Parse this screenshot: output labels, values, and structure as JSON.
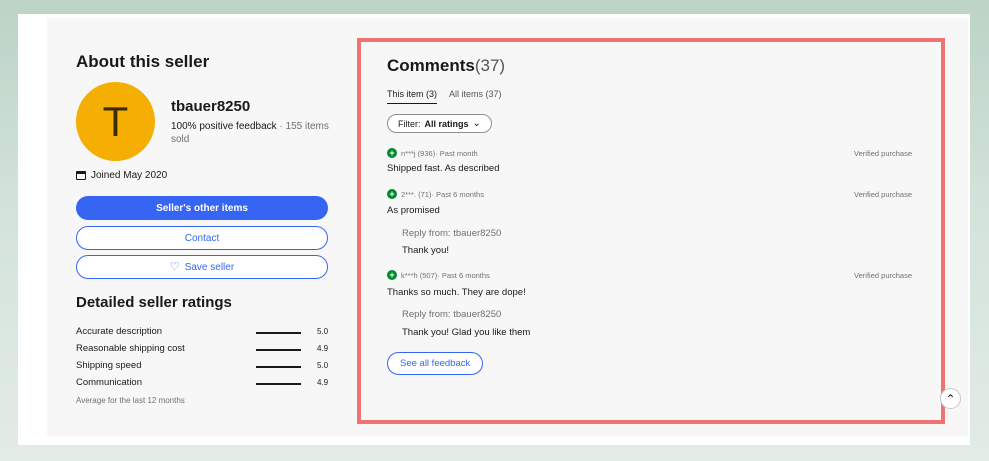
{
  "seller": {
    "heading": "About this seller",
    "avatar_letter": "T",
    "username": "tbauer8250",
    "feedback": "100% positive feedback",
    "items_sold": " · 155 items sold",
    "joined": "Joined May 2020",
    "buttons": {
      "other_items": "Seller's other items",
      "contact": "Contact",
      "save": "Save seller"
    }
  },
  "ratings": {
    "heading": "Detailed seller ratings",
    "items": [
      {
        "label": "Accurate description",
        "value": "5.0"
      },
      {
        "label": "Reasonable shipping cost",
        "value": "4.9"
      },
      {
        "label": "Shipping speed",
        "value": "5.0"
      },
      {
        "label": "Communication",
        "value": "4.9"
      }
    ],
    "footnote": "Average for the last 12 months"
  },
  "comments": {
    "title": "Comments",
    "count": "(37)",
    "tabs": [
      "This item (3)",
      "All items (37)"
    ],
    "filter_prefix": "Filter: ",
    "filter_value": "All ratings",
    "items": [
      {
        "user": "n***j (936)",
        "time": " · Past month",
        "badge": "Verified purchase",
        "text": "Shipped fast. As described"
      },
      {
        "user": "2***. (71)",
        "time": " · Past 6 months",
        "badge": "Verified purchase",
        "text": "As promised",
        "reply_from": "Reply from: tbauer8250",
        "reply": "Thank you!"
      },
      {
        "user": "k***h (507)",
        "time": " · Past 6 months",
        "badge": "Verified purchase",
        "text": "Thanks so much. They are dope!",
        "reply_from": "Reply from: tbauer8250",
        "reply": "Thank you! Glad you like them"
      }
    ],
    "see_all": "See all feedback"
  },
  "colors": {
    "accent": "#3665f3",
    "avatar": "#f5af02",
    "highlight_border": "#f07373",
    "positive": "#008a2e"
  },
  "icons": {
    "calendar": "calendar-icon",
    "heart": "heart-icon",
    "chevron": "chevron-down-icon",
    "positive": "positive-feedback-icon",
    "scroll_top": "chevron-up-icon"
  }
}
